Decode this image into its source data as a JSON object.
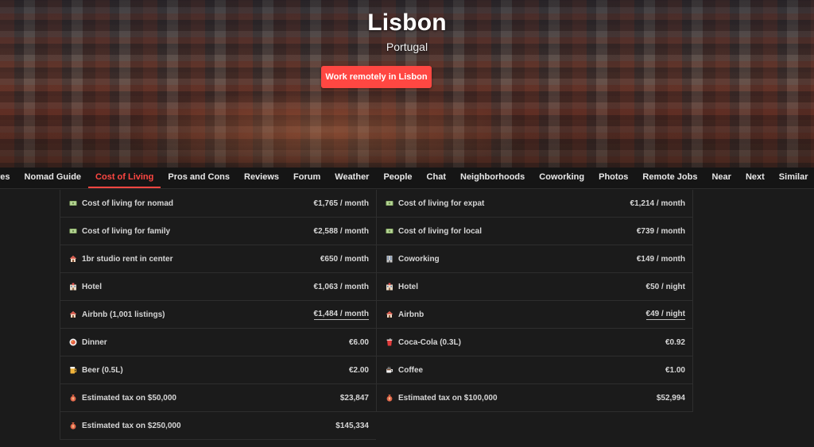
{
  "hero": {
    "city": "Lisbon",
    "country": "Portugal",
    "cta_label": "Work remotely in Lisbon"
  },
  "tabs": [
    {
      "label": "res"
    },
    {
      "label": "Nomad Guide"
    },
    {
      "label": "Cost of Living",
      "active": true
    },
    {
      "label": "Pros and Cons"
    },
    {
      "label": "Reviews"
    },
    {
      "label": "Forum"
    },
    {
      "label": "Weather"
    },
    {
      "label": "People"
    },
    {
      "label": "Chat"
    },
    {
      "label": "Neighborhoods"
    },
    {
      "label": "Coworking"
    },
    {
      "label": "Photos"
    },
    {
      "label": "Remote Jobs"
    },
    {
      "label": "Near"
    },
    {
      "label": "Next"
    },
    {
      "label": "Similar"
    }
  ],
  "accent_color": "#ff4742",
  "costs": [
    {
      "label": "Cost of living for nomad",
      "value": "€1,765 / month",
      "icon": "money-icon"
    },
    {
      "label": "Cost of living for expat",
      "value": "€1,214 / month",
      "icon": "money-icon"
    },
    {
      "label": "Cost of living for family",
      "value": "€2,588 / month",
      "icon": "money-icon"
    },
    {
      "label": "Cost of living for local",
      "value": "€739 / month",
      "icon": "money-icon"
    },
    {
      "label": "1br studio rent in center",
      "value": "€650 / month",
      "icon": "house-icon"
    },
    {
      "label": "Coworking",
      "value": "€149 / month",
      "icon": "office-icon"
    },
    {
      "label": "Hotel",
      "value": "€1,063 / month",
      "icon": "hotel-icon"
    },
    {
      "label": "Hotel",
      "value": "€50 / night",
      "icon": "hotel-icon"
    },
    {
      "label": "Airbnb (1,001 listings)",
      "value": "€1,484 / month",
      "icon": "house-icon",
      "underline": true
    },
    {
      "label": "Airbnb",
      "value": "€49 / night",
      "icon": "house-icon",
      "underline": true
    },
    {
      "label": "Dinner",
      "value": "€6.00",
      "icon": "dinner-icon"
    },
    {
      "label": "Coca-Cola (0.3L)",
      "value": "€0.92",
      "icon": "soda-cup-icon"
    },
    {
      "label": "Beer (0.5L)",
      "value": "€2.00",
      "icon": "beer-icon"
    },
    {
      "label": "Coffee",
      "value": "€1.00",
      "icon": "coffee-icon"
    },
    {
      "label": "Estimated tax on $50,000",
      "value": "$23,847",
      "icon": "money-bag-icon"
    },
    {
      "label": "Estimated tax on $100,000",
      "value": "$52,994",
      "icon": "money-bag-icon"
    },
    {
      "label": "Estimated tax on $250,000",
      "value": "$145,334",
      "icon": "money-bag-icon"
    }
  ]
}
